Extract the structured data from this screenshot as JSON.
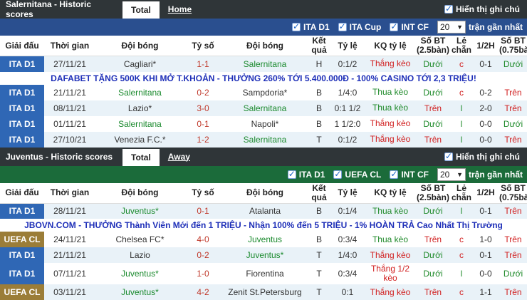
{
  "section1": {
    "title": "Salernitana - Historic scores",
    "tab_active": "Total",
    "tab_other": "Home",
    "show_label": "Hiển thị ghi chú",
    "filters": [
      "ITA D1",
      "ITA Cup",
      "INT CF"
    ],
    "select_value": "20",
    "select_suffix": "trận gần nhất",
    "headers": [
      "Giải đấu",
      "Thời gian",
      "Đội bóng",
      "Tỷ số",
      "Đội bóng",
      "Kết quả",
      "Tỷ lệ",
      "KQ tỷ lệ",
      "Số BT (2.5bàn)",
      "Lẻ chẵn",
      "1/2H",
      "Số BT (0.75bàn)"
    ],
    "rows": [
      {
        "league": "ITA D1",
        "date": "27/11/21",
        "home": "Cagliari*",
        "score": "1-1",
        "away": "Salernitana",
        "res": "H",
        "odds": "0:1/2",
        "kq": "Thắng kèo",
        "bt": "Dưới",
        "lc": "c",
        "half": "0-1",
        "bt2": "Dưới"
      },
      {
        "league": "ITA D1",
        "date": "21/11/21",
        "home": "Salernitana",
        "score": "0-2",
        "away": "Sampdoria*",
        "res": "B",
        "odds": "1/4:0",
        "kq": "Thua kèo",
        "bt": "Dưới",
        "lc": "c",
        "half": "0-2",
        "bt2": "Trên"
      },
      {
        "league": "ITA D1",
        "date": "08/11/21",
        "home": "Lazio*",
        "score": "3-0",
        "away": "Salernitana",
        "res": "B",
        "odds": "0:1 1/2",
        "kq": "Thua kèo",
        "bt": "Trên",
        "lc": "l",
        "half": "2-0",
        "bt2": "Trên"
      },
      {
        "league": "ITA D1",
        "date": "01/11/21",
        "home": "Salernitana",
        "score": "0-1",
        "away": "Napoli*",
        "res": "B",
        "odds": "1 1/2:0",
        "kq": "Thắng kèo",
        "bt": "Dưới",
        "lc": "l",
        "half": "0-0",
        "bt2": "Dưới"
      },
      {
        "league": "ITA D1",
        "date": "27/10/21",
        "home": "Venezia F.C.*",
        "score": "1-2",
        "away": "Salernitana",
        "res": "T",
        "odds": "0:1/2",
        "kq": "Thắng kèo",
        "bt": "Trên",
        "lc": "l",
        "half": "0-0",
        "bt2": "Trên"
      }
    ],
    "ad": "DAFABET TẶNG 500K KHI MỞ T.KHOẢN - THƯỞNG 260% TỚI 5.400.000Đ - 100% CASINO TỚI 2,3 TRIỆU!"
  },
  "section2": {
    "title": "Juventus - Historic scores",
    "tab_active": "Total",
    "tab_other": "Away",
    "show_label": "Hiển thị ghi chú",
    "filters": [
      "ITA D1",
      "UEFA CL",
      "INT CF"
    ],
    "select_value": "20",
    "select_suffix": "trận gần nhất",
    "headers": [
      "Giải đấu",
      "Thời gian",
      "Đội bóng",
      "Tỷ số",
      "Đội bóng",
      "Kết quả",
      "Tỷ lệ",
      "KQ tỷ lệ",
      "Số BT (2.5bàn)",
      "Lẻ chẵn",
      "1/2H",
      "Số BT (0.75bàn)"
    ],
    "rows": [
      {
        "league": "ITA D1",
        "date": "28/11/21",
        "home": "Juventus*",
        "score": "0-1",
        "away": "Atalanta",
        "res": "B",
        "odds": "0:1/4",
        "kq": "Thua kèo",
        "bt": "Dưới",
        "lc": "l",
        "half": "0-1",
        "bt2": "Trên"
      },
      {
        "league": "UEFA CL",
        "date": "24/11/21",
        "home": "Chelsea FC*",
        "score": "4-0",
        "away": "Juventus",
        "res": "B",
        "odds": "0:3/4",
        "kq": "Thua kèo",
        "bt": "Trên",
        "lc": "c",
        "half": "1-0",
        "bt2": "Trên"
      },
      {
        "league": "ITA D1",
        "date": "21/11/21",
        "home": "Lazio",
        "score": "0-2",
        "away": "Juventus*",
        "res": "T",
        "odds": "1/4:0",
        "kq": "Thắng kèo",
        "bt": "Dưới",
        "lc": "c",
        "half": "0-1",
        "bt2": "Trên"
      },
      {
        "league": "ITA D1",
        "date": "07/11/21",
        "home": "Juventus*",
        "score": "1-0",
        "away": "Fiorentina",
        "res": "T",
        "odds": "0:3/4",
        "kq": "Thắng 1/2 kèo",
        "bt": "Dưới",
        "lc": "l",
        "half": "0-0",
        "bt2": "Dưới"
      },
      {
        "league": "UEFA CL",
        "date": "03/11/21",
        "home": "Juventus*",
        "score": "4-2",
        "away": "Zenit St.Petersburg",
        "res": "T",
        "odds": "0:1",
        "kq": "Thắng kèo",
        "bt": "Trên",
        "lc": "c",
        "half": "1-1",
        "bt2": "Trên"
      }
    ],
    "ad": "JBOVN.COM - THƯỞNG Thành Viên Mới đến 1 TRIỆU - Nhận 100% đến 5 TRIỆU - 1% HOÀN TRẢ Cao Nhất Thị Trường"
  }
}
